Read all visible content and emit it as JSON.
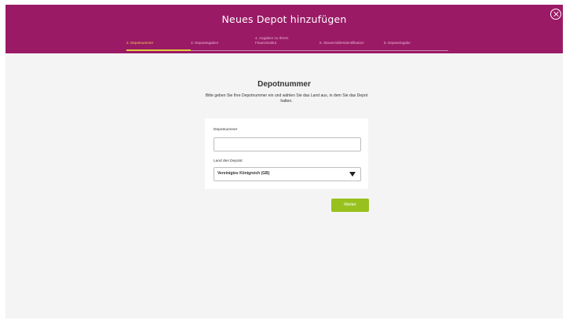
{
  "header": {
    "title": "Neues Depot hinzufügen"
  },
  "steps": [
    {
      "label": "2. Depotnummer"
    },
    {
      "label": "3. Depotangaben"
    },
    {
      "label": "4. Angaben zu Ihrem Finanzinstitut"
    },
    {
      "label": "5. Steuerzahleridentifikation"
    },
    {
      "label": "6. Depoteingabe"
    }
  ],
  "main": {
    "heading": "Depotnummer",
    "intro": "Bitte geben Sie Ihre Depotnummer ein und wählen Sie das Land aus, in dem Sie das Depot halten.",
    "depot_label": "Depotnummer",
    "depot_value": "",
    "country_label": "Land des Depots:",
    "country_value": "Vereinigtes Königreich (GB)",
    "next_label": "Weiter"
  },
  "colors": {
    "header": "#9a1a66",
    "accent": "#e0cc39",
    "button": "#98c11d"
  }
}
